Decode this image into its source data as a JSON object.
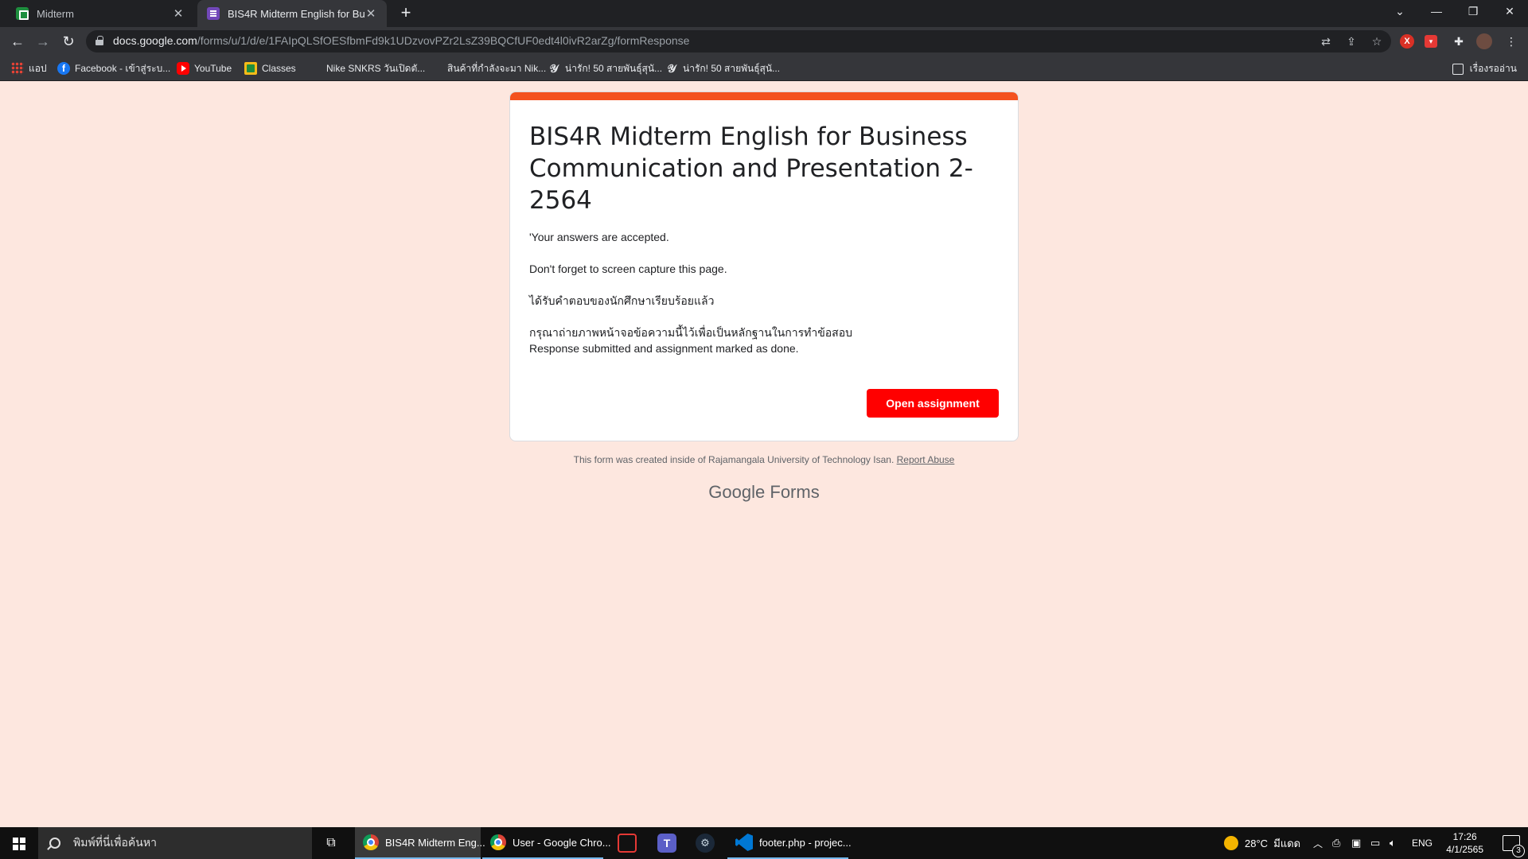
{
  "browser": {
    "tabs": [
      {
        "title": "Midterm",
        "icon": "google-sheets-icon",
        "active": false
      },
      {
        "title": "BIS4R Midterm English for Business Communication and Presentation 2-2564",
        "icon": "google-forms-icon",
        "active": true
      }
    ],
    "url_host": "docs.google.com",
    "url_path": "/forms/u/1/d/e/1FAIpQLSfOESfbmFd9k1UDzvovPZr2LsZ39BQCfUF0edt4l0ivR2arZg/formResponse",
    "bookmarks": [
      {
        "label": "แอป",
        "icon": "apps-grid-icon"
      },
      {
        "label": "Facebook - เข้าสู่ระบ...",
        "icon": "facebook-icon"
      },
      {
        "label": "YouTube",
        "icon": "youtube-icon"
      },
      {
        "label": "Classes",
        "icon": "google-classroom-icon"
      },
      {
        "label": "Nike SNKRS วันเปิดตั...",
        "icon": "nike-icon"
      },
      {
        "label": "สินค้าที่กำลังจะมา Nik...",
        "icon": "nike-icon"
      },
      {
        "label": "น่ารัก! 50 สายพันธุ์สุนั...",
        "icon": "site-icon"
      },
      {
        "label": "น่ารัก! 50 สายพันธุ์สุนั...",
        "icon": "site-icon"
      }
    ],
    "reading_list": "เรื่องรออ่าน"
  },
  "form": {
    "accent_color": "#f4511e",
    "background_color": "#fde7df",
    "title": "BIS4R Midterm English for Business Communication and Presentation 2-2564",
    "messages": [
      "'Your answers are accepted.",
      "Don't forget to screen capture this page.",
      "ได้รับคำตอบของนักศึกษาเรียบร้อยแล้ว",
      "กรุณาถ่ายภาพหน้าจอข้อความนี้ไว้เพื่อเป็นหลักฐานในการทำข้อสอบ"
    ],
    "confirmation": "Response submitted and assignment marked as done.",
    "open_button_label": "Open assignment",
    "button_color": "#ff0000",
    "footer_text": "This form was created inside of Rajamangala University of Technology Isan.",
    "report_abuse": "Report Abuse",
    "brand_google": "Google",
    "brand_forms": "Forms"
  },
  "taskbar": {
    "search_placeholder": "พิมพ์ที่นี่เพื่อค้นหา",
    "apps": [
      {
        "label": "BIS4R Midterm Eng...",
        "icon": "chrome-icon"
      },
      {
        "label": "User - Google Chro...",
        "icon": "chrome-icon"
      },
      {
        "label": "",
        "icon": "garena-icon"
      },
      {
        "label": "",
        "icon": "teams-icon"
      },
      {
        "label": "",
        "icon": "steam-icon"
      },
      {
        "label": "footer.php - projec...",
        "icon": "vscode-icon"
      }
    ],
    "weather": "28°C",
    "weather_text": "มีแดด",
    "language": "ENG",
    "time": "17:26",
    "date": "4/1/2565",
    "notifications": "3"
  }
}
